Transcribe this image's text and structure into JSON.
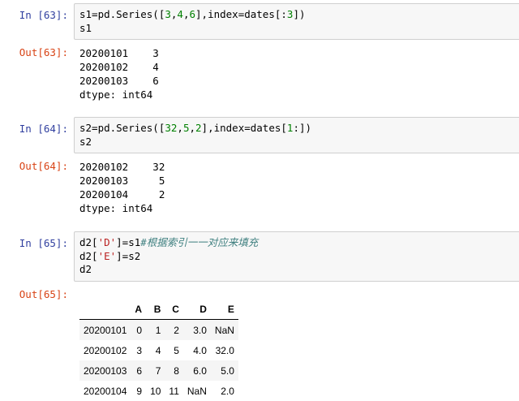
{
  "cells": [
    {
      "in_prompt": "In [63]:",
      "out_prompt": "Out[63]:",
      "code": [
        {
          "pre": "s1=pd.Series([",
          "n1": "3",
          "c1": ",",
          "n2": "4",
          "c2": ",",
          "n3": "6",
          "post": "],index=dates[:",
          "n4": "3",
          "tail": "])"
        },
        {
          "plain": "s1"
        }
      ],
      "output": [
        "20200101    3",
        "20200102    4",
        "20200103    6",
        "dtype: int64"
      ]
    },
    {
      "in_prompt": "In [64]:",
      "out_prompt": "Out[64]:",
      "code": [
        {
          "pre": "s2=pd.Series([",
          "n1": "32",
          "c1": ",",
          "n2": "5",
          "c2": ",",
          "n3": "2",
          "post": "],index=dates[",
          "n4": "1",
          "tail": ":])"
        },
        {
          "plain": "s2"
        }
      ],
      "output": [
        "20200102    32",
        "20200103     5",
        "20200104     2",
        "dtype: int64"
      ]
    },
    {
      "in_prompt": "In [65]:",
      "out_prompt": "Out[65]:",
      "code_line1": {
        "a": "d2[",
        "str": "'D'",
        "b": "]=s1",
        "comment": "#根据索引一一对应来填充"
      },
      "code_line2": {
        "a": "d2[",
        "str": "'E'",
        "b": "]=s2"
      },
      "code_line3": "d2",
      "table": {
        "columns": [
          "",
          "A",
          "B",
          "C",
          "D",
          "E"
        ],
        "rows": [
          [
            "20200101",
            "0",
            "1",
            "2",
            "3.0",
            "NaN"
          ],
          [
            "20200102",
            "3",
            "4",
            "5",
            "4.0",
            "32.0"
          ],
          [
            "20200103",
            "6",
            "7",
            "8",
            "6.0",
            "5.0"
          ],
          [
            "20200104",
            "9",
            "10",
            "11",
            "NaN",
            "2.0"
          ]
        ]
      }
    }
  ]
}
